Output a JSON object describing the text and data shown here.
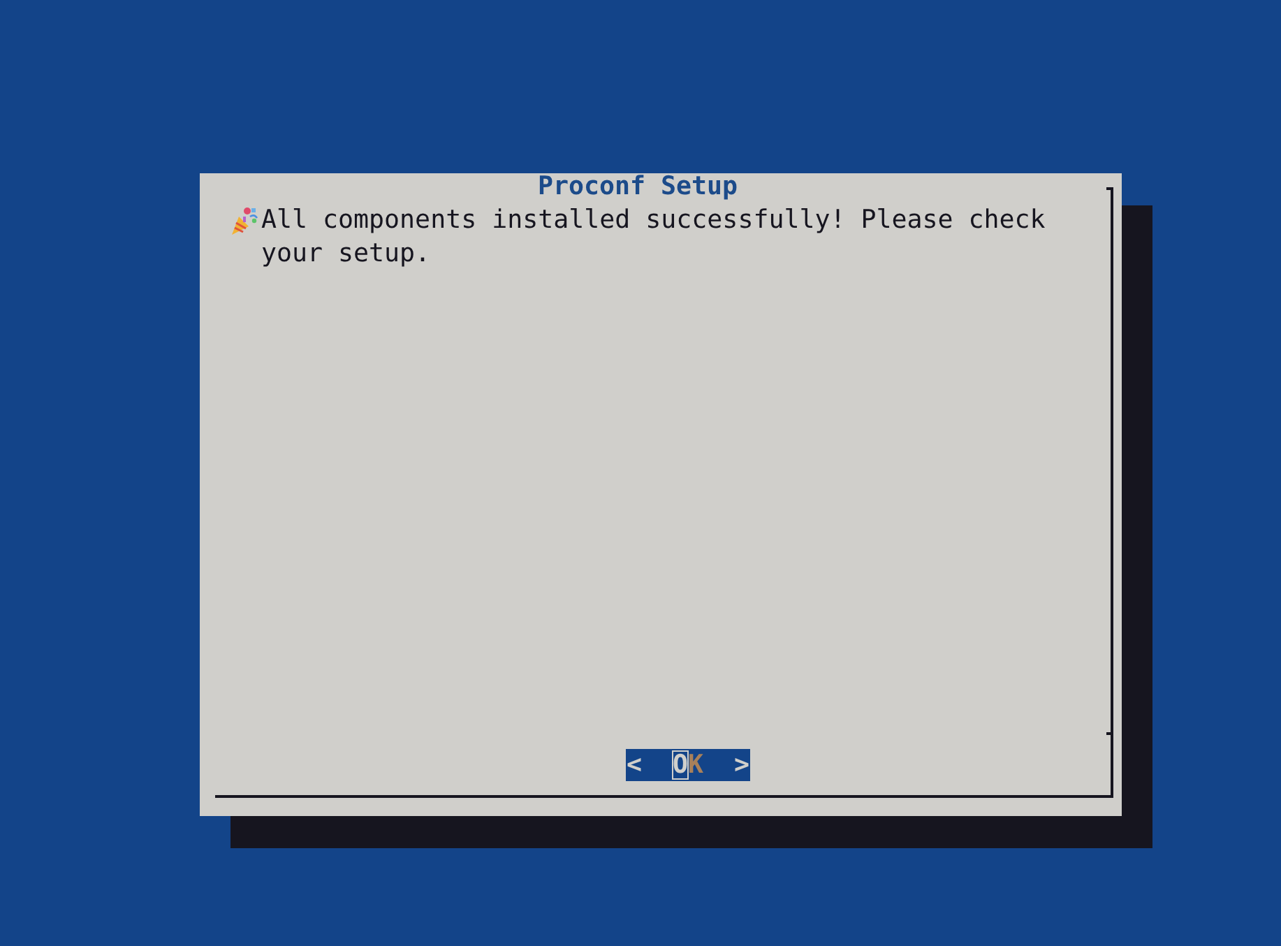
{
  "dialog": {
    "title": "Proconf Setup",
    "message": "All components installed successfully! Please check your setup.",
    "button": {
      "left": "<",
      "label": "OK",
      "right": ">",
      "focused": true
    }
  }
}
